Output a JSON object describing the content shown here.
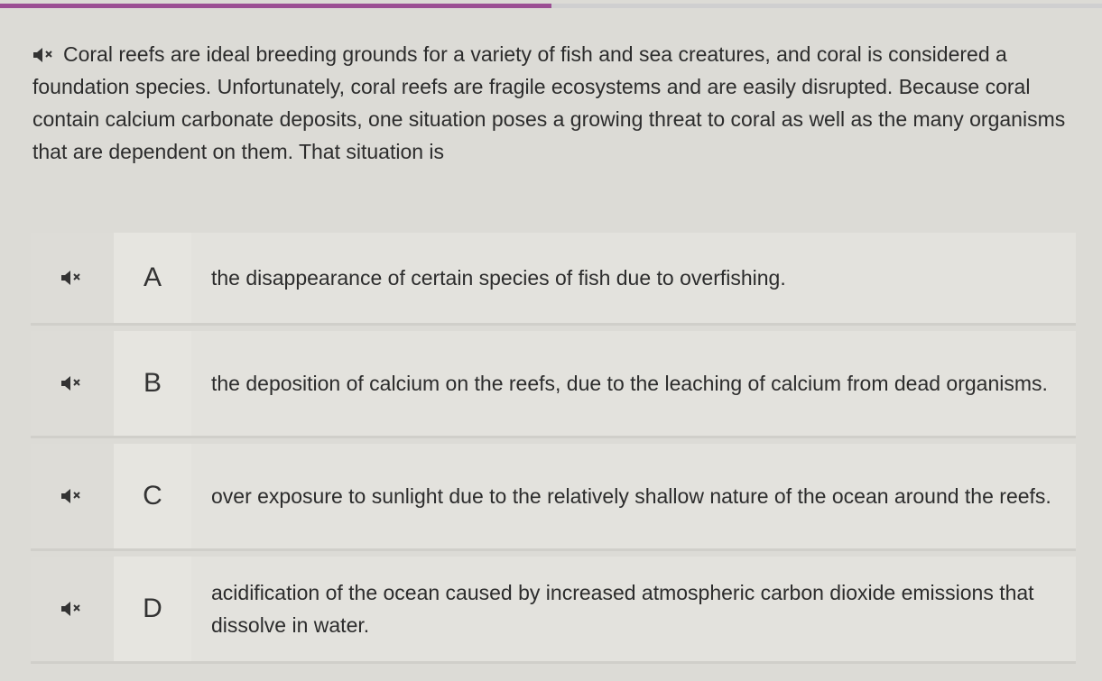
{
  "progress": {
    "fraction": 0.5
  },
  "question": {
    "speaker_icon": "speaker-mute-icon",
    "text": "Coral reefs are ideal breeding grounds for a variety of fish and sea creatures, and coral is considered a foundation species. Unfortunately, coral reefs are fragile ecosystems and are easily disrupted. Because coral contain calcium carbonate deposits, one situation poses a growing threat to coral as well as the many organisms that are dependent on them. That situation is"
  },
  "options": [
    {
      "letter": "A",
      "text": "the disappearance of certain species of fish due to overfishing."
    },
    {
      "letter": "B",
      "text": "the deposition of calcium on the reefs, due to the leaching of calcium from dead organisms."
    },
    {
      "letter": "C",
      "text": "over exposure to sunlight due to the relatively shallow nature of the ocean around the reefs."
    },
    {
      "letter": "D",
      "text": "acidification of the ocean caused by increased atmospheric carbon dioxide emissions that dissolve in water."
    }
  ]
}
